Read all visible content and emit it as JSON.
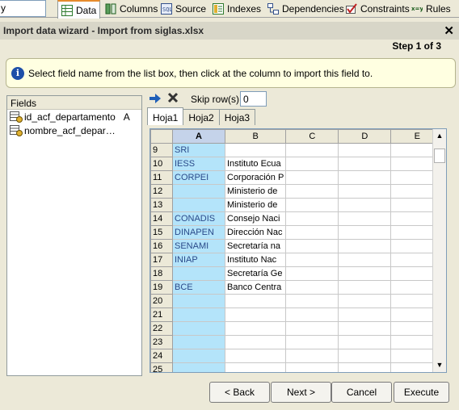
{
  "toolbar": {
    "combo_value": "y",
    "tabs": [
      {
        "label": "Data",
        "icon": "data-grid-icon"
      },
      {
        "label": "Columns",
        "icon": "columns-icon"
      },
      {
        "label": "Source",
        "icon": "source-icon"
      },
      {
        "label": "Indexes",
        "icon": "indexes-icon"
      },
      {
        "label": "Dependencies",
        "icon": "dependencies-icon"
      },
      {
        "label": "Constraints",
        "icon": "constraints-icon"
      },
      {
        "label": "Rules",
        "icon": "rules-icon"
      }
    ]
  },
  "dialog": {
    "title": "Import data wizard - Import from siglas.xlsx",
    "step": "Step 1 of 3",
    "info": "Select field name from the list box, then click at the column to import this field to."
  },
  "fields": {
    "header": "Fields",
    "items": [
      {
        "name": "id_acf_departamento",
        "column": "A"
      },
      {
        "name": "nombre_acf_depar…",
        "column": ""
      }
    ]
  },
  "skip": {
    "label": "Skip row(s)",
    "value": "0"
  },
  "sheets": [
    "Hoja1",
    "Hoja2",
    "Hoja3"
  ],
  "grid": {
    "columns": [
      "",
      "A",
      "B",
      "C",
      "D",
      "E"
    ],
    "rows": [
      {
        "n": "9",
        "a": "SRI",
        "b": ""
      },
      {
        "n": "10",
        "a": "IESS",
        "b": "Instituto Ecua"
      },
      {
        "n": "11",
        "a": "CORPEI",
        "b": "Corporación P"
      },
      {
        "n": "12",
        "a": "",
        "b": "Ministerio de"
      },
      {
        "n": "13",
        "a": "",
        "b": "Ministerio de"
      },
      {
        "n": "14",
        "a": "CONADIS",
        "b": "Consejo Naci"
      },
      {
        "n": "15",
        "a": "DINAPEN",
        "b": "Dirección Nac"
      },
      {
        "n": "16",
        "a": "SENAMI",
        "b": "Secretaría na"
      },
      {
        "n": "17",
        "a": "INIAP",
        "b": "Instituto Nac"
      },
      {
        "n": "18",
        "a": "",
        "b": "Secretaría Ge"
      },
      {
        "n": "19",
        "a": "BCE",
        "b": "Banco Centra"
      },
      {
        "n": "20",
        "a": "",
        "b": ""
      },
      {
        "n": "21",
        "a": "",
        "b": ""
      },
      {
        "n": "22",
        "a": "",
        "b": ""
      },
      {
        "n": "23",
        "a": "",
        "b": ""
      },
      {
        "n": "24",
        "a": "",
        "b": ""
      },
      {
        "n": "25",
        "a": "",
        "b": ""
      }
    ]
  },
  "buttons": {
    "back": "< Back",
    "next": "Next >",
    "cancel": "Cancel",
    "execute": "Execute"
  }
}
